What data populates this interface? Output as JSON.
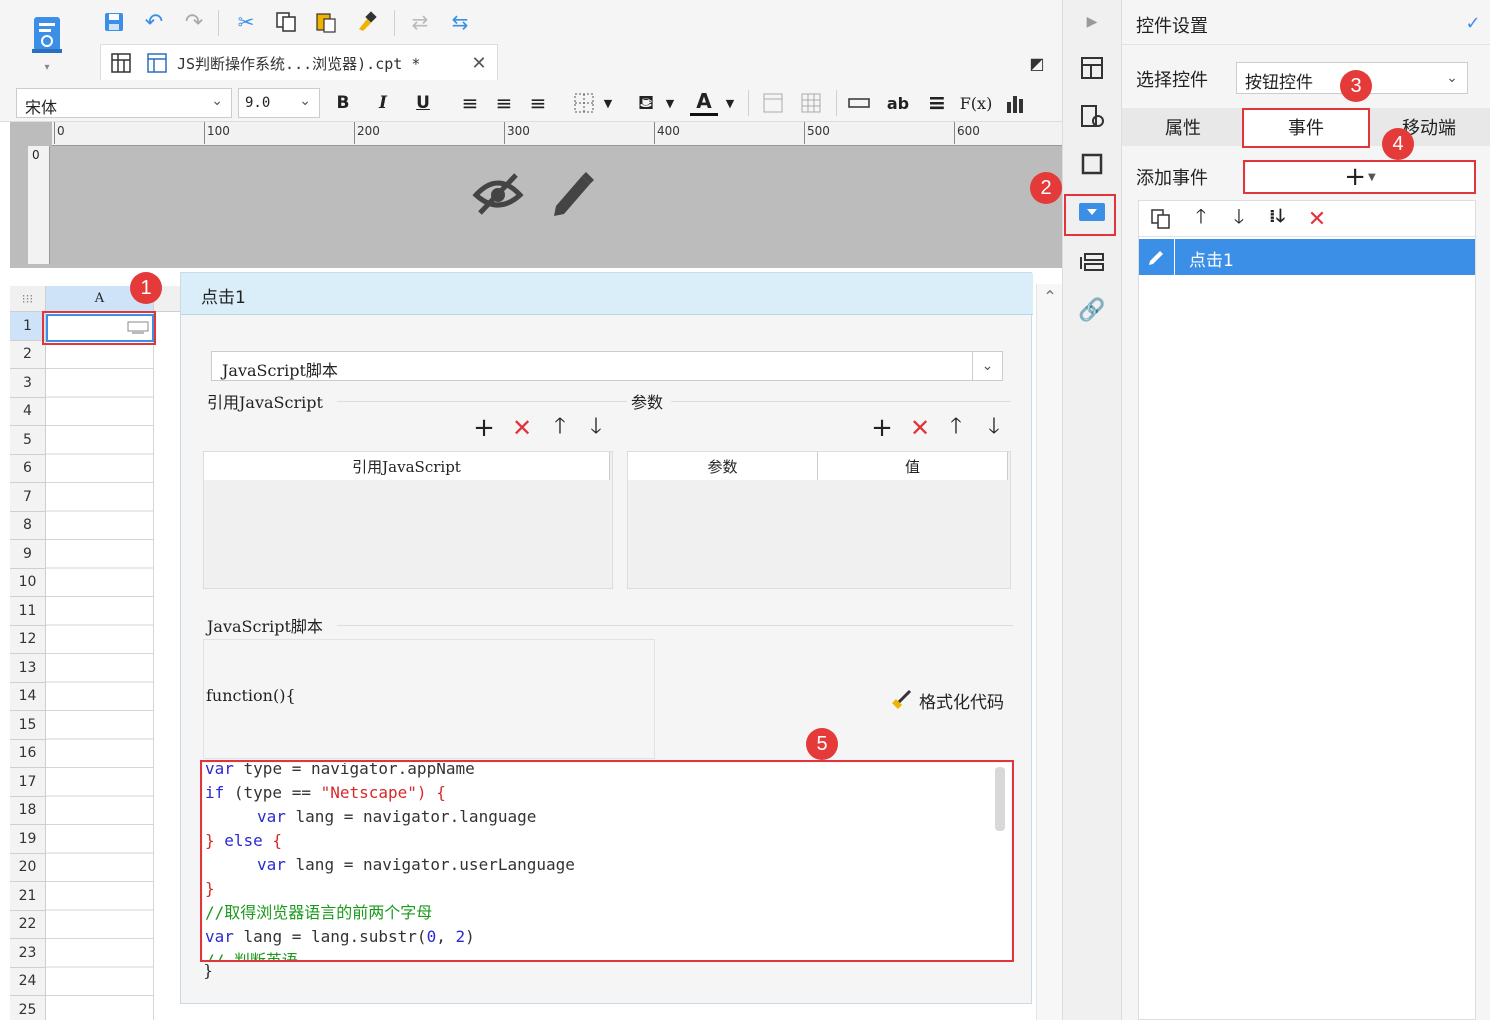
{
  "toolbar": {
    "tab_title": "JS判断操作系统...浏览器).cpt *",
    "font_name": "宋体",
    "font_size": "9.0",
    "bold": "B",
    "italic": "I",
    "underline": "U",
    "text_ab": "ab",
    "fx": "F(x)",
    "text_color_glyph": "A"
  },
  "ruler": {
    "labels": [
      "0",
      "100",
      "200",
      "300",
      "400",
      "500",
      "600"
    ],
    "vertical_label": "0"
  },
  "sheet": {
    "column_header": "A",
    "rows": [
      "1",
      "2",
      "3",
      "4",
      "5",
      "6",
      "7",
      "8",
      "9",
      "10",
      "11",
      "12",
      "13",
      "14",
      "15",
      "16",
      "17",
      "18",
      "19",
      "20",
      "21",
      "22",
      "23",
      "24",
      "25"
    ]
  },
  "dialog": {
    "title": "点击1",
    "script_type": "JavaScript脚本",
    "ref_js_label": "引用JavaScript",
    "params_label": "参数",
    "ref_js_col": "引用JavaScript",
    "param_col": "参数",
    "value_col": "值",
    "js_script_label": "JavaScript脚本",
    "function_sig": "function(){",
    "format_code": "格式化代码",
    "closing_brace": "}",
    "code": {
      "l1_kw": "var",
      "l1_rest": " type = navigator.appName",
      "l2_kw": "if",
      "l2_a": " (type == ",
      "l2_str": "\"Netscape\"",
      "l2_b": ") {",
      "l3_kw": "var",
      "l3_rest": " lang = navigator.language",
      "l4_a": "} ",
      "l4_kw": "else",
      "l4_b": " {",
      "l5_kw": "var",
      "l5_rest": " lang = navigator.userLanguage",
      "l6": "}",
      "l7": "//取得浏览器语言的前两个字母",
      "l8_kw": "var",
      "l8_a": " lang = lang.substr(",
      "l8_n1": "0",
      "l8_b": ", ",
      "l8_n2": "2",
      "l8_c": ")",
      "l9": "// 判断英语"
    }
  },
  "panel": {
    "title": "控件设置",
    "select_label": "选择控件",
    "select_value": "按钮控件",
    "tab_properties": "属性",
    "tab_events": "事件",
    "tab_mobile": "移动端",
    "add_event_label": "添加事件",
    "add_glyph": "+",
    "event_item": "点击1"
  },
  "badges": [
    "1",
    "2",
    "3",
    "4",
    "5"
  ],
  "colors": {
    "accent_blue": "#3c8fe6",
    "highlight_red": "#e2343b",
    "selected_row": "#3c8fe6",
    "dialog_header": "#d9eef9"
  }
}
